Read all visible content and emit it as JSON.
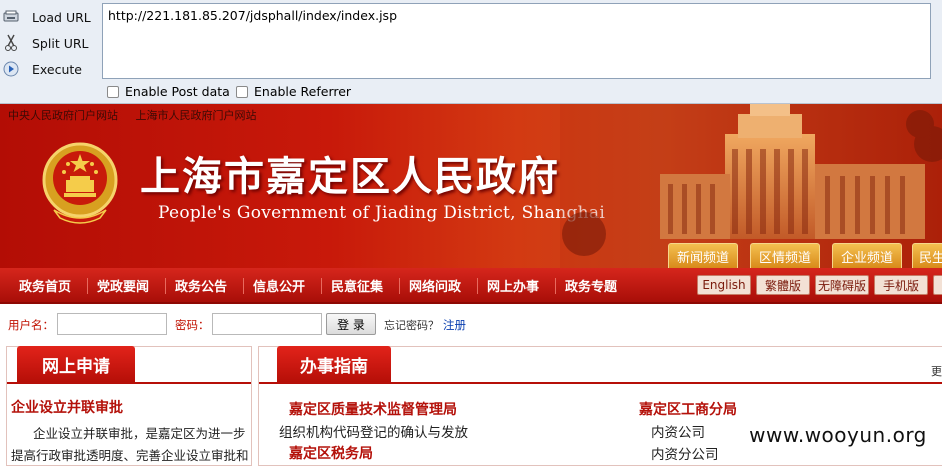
{
  "hackbar": {
    "load_url": "Load URL",
    "split_url": "Split URL",
    "execute": "Execute",
    "url_value": "http://221.181.85.207/jdsphall/index/index.jsp",
    "enable_post": "Enable Post data",
    "enable_referrer": "Enable Referrer"
  },
  "top_links": [
    "中央人民政府门户网站",
    "上海市人民政府门户网站"
  ],
  "site": {
    "title": "上海市嘉定区人民政府",
    "subtitle": "People's Government of Jiading District, Shanghai"
  },
  "channel_tabs": [
    "新闻频道",
    "区情频道",
    "企业频道",
    "民生"
  ],
  "nav": [
    "政务首页",
    "党政要闻",
    "政务公告",
    "信息公开",
    "民意征集",
    "网络问政",
    "网上办事",
    "政务专题"
  ],
  "languages": [
    "English",
    "繁體版",
    "无障碍版",
    "手机版"
  ],
  "login": {
    "username_label": "用户名：",
    "password_label": "密码：",
    "login_button": "登 录",
    "forgot": "忘记密码？",
    "register": "注册"
  },
  "left_panel": {
    "title": "网上申请",
    "link": "企业设立并联审批",
    "text_1": "企业设立并联审批，是嘉定区为进一步",
    "text_2": "提高行政审批透明度、完善企业设立审批和"
  },
  "right_panel": {
    "title": "办事指南",
    "more": "更",
    "col1_heading": "嘉定区质量技术监督管理局",
    "col1_item": "组织机构代码登记的确认与发放",
    "col1_heading_2": "嘉定区税务局",
    "col2_heading": "嘉定区工商分局",
    "col2_item_1": "内资公司",
    "col2_item_2": "内资分公司"
  },
  "watermark": "www.wooyun.org",
  "colors": {
    "primary_red": "#c8190a",
    "gold": "#e0a030"
  }
}
